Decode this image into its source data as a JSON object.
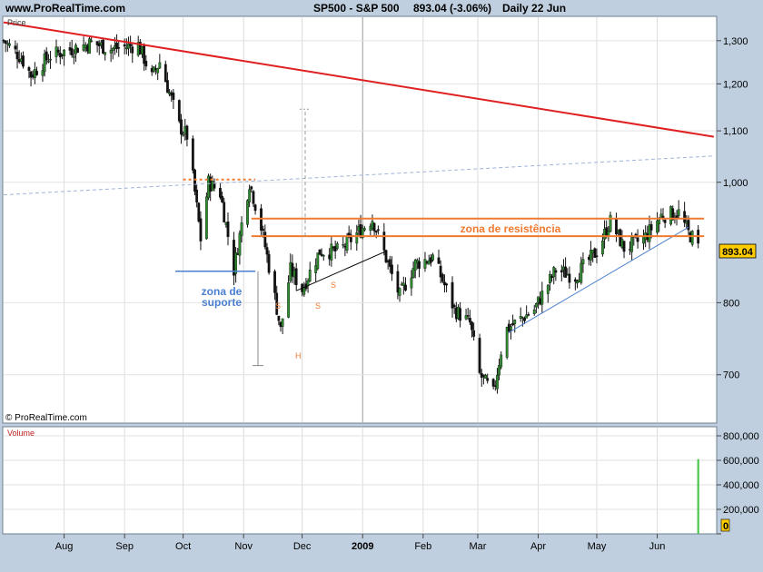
{
  "header": {
    "site": "www.ProRealTime.com",
    "instrument": "SP500 - S&P 500",
    "quote": "893.04 (-3.06%)",
    "period": "Daily  22 Jun"
  },
  "price_panel": {
    "label": "Price",
    "watermark": "© ProRealTime.com",
    "last_price": "893.04"
  },
  "volume_panel": {
    "label": "Volume"
  },
  "colors": {
    "up": "#2e8b2e",
    "down": "#111111",
    "resistance_trend": "#e02020",
    "support_zone": "#4a7fd0",
    "resistance_zone": "#f07a30",
    "volume": "#3ec43e"
  },
  "annotations": {
    "support_zone_line1": "zona de",
    "support_zone_line2": "suporte",
    "resistance_zone": "zona de resistência",
    "left_shoulder": "S",
    "right_shoulder_1": "S",
    "right_shoulder_2": "S",
    "head": "H"
  },
  "chart_data": [
    {
      "type": "candlestick",
      "title": "SP500 - S&P 500",
      "x_tick_labels": [
        "Aug",
        "Sep",
        "Oct",
        "Nov",
        "Dec",
        "2009",
        "Feb",
        "Mar",
        "Apr",
        "May",
        "Jun"
      ],
      "y_tick_labels": [
        "1,300",
        "1,200",
        "1,100",
        "1,000",
        "800",
        "700"
      ],
      "y_ticks": [
        1300,
        1200,
        1100,
        1000,
        800,
        700
      ],
      "ylim": [
        640,
        1360
      ],
      "y_scale": "log",
      "grid": true,
      "close_path": [
        {
          "x": "2008-07-01",
          "y": 1300
        },
        {
          "x": "2008-07-10",
          "y": 1260
        },
        {
          "x": "2008-07-15",
          "y": 1220
        },
        {
          "x": "2008-07-25",
          "y": 1265
        },
        {
          "x": "2008-08-05",
          "y": 1280
        },
        {
          "x": "2008-08-15",
          "y": 1295
        },
        {
          "x": "2008-08-25",
          "y": 1280
        },
        {
          "x": "2008-09-01",
          "y": 1285
        },
        {
          "x": "2008-09-08",
          "y": 1290
        },
        {
          "x": "2008-09-15",
          "y": 1215
        },
        {
          "x": "2008-09-19",
          "y": 1250
        },
        {
          "x": "2008-09-29",
          "y": 1110
        },
        {
          "x": "2008-10-03",
          "y": 1090
        },
        {
          "x": "2008-10-10",
          "y": 900
        },
        {
          "x": "2008-10-14",
          "y": 1000
        },
        {
          "x": "2008-10-20",
          "y": 980
        },
        {
          "x": "2008-10-27",
          "y": 850
        },
        {
          "x": "2008-11-04",
          "y": 1000
        },
        {
          "x": "2008-11-10",
          "y": 920
        },
        {
          "x": "2008-11-20",
          "y": 760
        },
        {
          "x": "2008-11-25",
          "y": 850
        },
        {
          "x": "2008-12-01",
          "y": 820
        },
        {
          "x": "2008-12-10",
          "y": 880
        },
        {
          "x": "2008-12-20",
          "y": 880
        },
        {
          "x": "2009-01-06",
          "y": 935
        },
        {
          "x": "2009-01-15",
          "y": 850
        },
        {
          "x": "2009-01-20",
          "y": 810
        },
        {
          "x": "2009-01-28",
          "y": 860
        },
        {
          "x": "2009-02-06",
          "y": 870
        },
        {
          "x": "2009-02-17",
          "y": 790
        },
        {
          "x": "2009-02-25",
          "y": 770
        },
        {
          "x": "2009-03-02",
          "y": 700
        },
        {
          "x": "2009-03-09",
          "y": 676
        },
        {
          "x": "2009-03-15",
          "y": 760
        },
        {
          "x": "2009-03-30",
          "y": 790
        },
        {
          "x": "2009-04-10",
          "y": 850
        },
        {
          "x": "2009-04-20",
          "y": 840
        },
        {
          "x": "2009-05-01",
          "y": 880
        },
        {
          "x": "2009-05-08",
          "y": 930
        },
        {
          "x": "2009-05-15",
          "y": 885
        },
        {
          "x": "2009-05-25",
          "y": 900
        },
        {
          "x": "2009-06-03",
          "y": 940
        },
        {
          "x": "2009-06-12",
          "y": 945
        },
        {
          "x": "2009-06-17",
          "y": 910
        },
        {
          "x": "2009-06-22",
          "y": 893.04
        }
      ],
      "lines": [
        {
          "name": "",
          "from": {
            "x": "2008-07-01",
            "y": 1345
          },
          "to": {
            "x": "2009-06-30",
            "y": 1088
          }
        },
        {
          "name": "",
          "from": {
            "x": "2008-07-01",
            "y": 977
          },
          "to": {
            "x": "2009-06-30",
            "y": 1050
          }
        },
        {
          "name": "",
          "from": {
            "x": "2009-03-17",
            "y": 757
          },
          "to": {
            "x": "2009-06-17",
            "y": 920
          }
        },
        {
          "name": "",
          "from": {
            "x": "2008-11-28",
            "y": 818
          },
          "to": {
            "x": "2009-01-13",
            "y": 880
          }
        },
        {
          "name": "",
          "level": 1005,
          "from": "2008-10-01",
          "to": "2008-11-07"
        },
        {
          "name": "",
          "level": 935,
          "from": "2008-11-05",
          "to": "2009-06-25"
        },
        {
          "name": "",
          "level": 905,
          "from": "2008-11-05",
          "to": "2009-06-25"
        },
        {
          "name": "",
          "level": 848,
          "from": "2008-09-27",
          "to": "2008-11-07"
        }
      ]
    },
    {
      "type": "bar",
      "title": "Volume",
      "y_tick_labels": [
        "800,000",
        "600,000",
        "400,000",
        "200,000",
        "0"
      ],
      "ylim": [
        0,
        800000
      ],
      "points": [
        {
          "x": "2009-06-22",
          "y": 610000
        }
      ]
    }
  ]
}
